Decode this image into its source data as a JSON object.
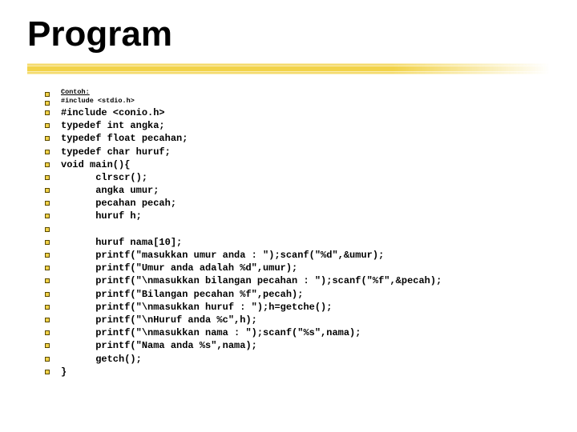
{
  "title": "Program",
  "lines": [
    {
      "cls": "small header",
      "t": "Contoh:"
    },
    {
      "cls": "small",
      "t": "#include <stdio.h>"
    },
    {
      "cls": "",
      "t": "#include <conio.h>"
    },
    {
      "cls": "",
      "t": "typedef int angka;"
    },
    {
      "cls": "",
      "t": "typedef float pecahan;"
    },
    {
      "cls": "",
      "t": "typedef char huruf;"
    },
    {
      "cls": "",
      "t": "void main(){"
    },
    {
      "cls": "",
      "t": "      clrscr();"
    },
    {
      "cls": "",
      "t": "      angka umur;"
    },
    {
      "cls": "",
      "t": "      pecahan pecah;"
    },
    {
      "cls": "",
      "t": "      huruf h;"
    },
    {
      "cls": "blank",
      "t": " "
    },
    {
      "cls": "",
      "t": "      huruf nama[10];"
    },
    {
      "cls": "",
      "t": "      printf(\"masukkan umur anda : \");scanf(\"%d\",&umur);"
    },
    {
      "cls": "",
      "t": "      printf(\"Umur anda adalah %d\",umur);"
    },
    {
      "cls": "",
      "t": "      printf(\"\\nmasukkan bilangan pecahan : \");scanf(\"%f\",&pecah);"
    },
    {
      "cls": "",
      "t": "      printf(\"Bilangan pecahan %f\",pecah);"
    },
    {
      "cls": "",
      "t": "      printf(\"\\nmasukkan huruf : \");h=getche();"
    },
    {
      "cls": "",
      "t": "      printf(\"\\nHuruf anda %c\",h);"
    },
    {
      "cls": "",
      "t": "      printf(\"\\nmasukkan nama : \");scanf(\"%s\",nama);"
    },
    {
      "cls": "",
      "t": "      printf(\"Nama anda %s\",nama);"
    },
    {
      "cls": "",
      "t": "      getch();"
    },
    {
      "cls": "",
      "t": "}"
    }
  ]
}
